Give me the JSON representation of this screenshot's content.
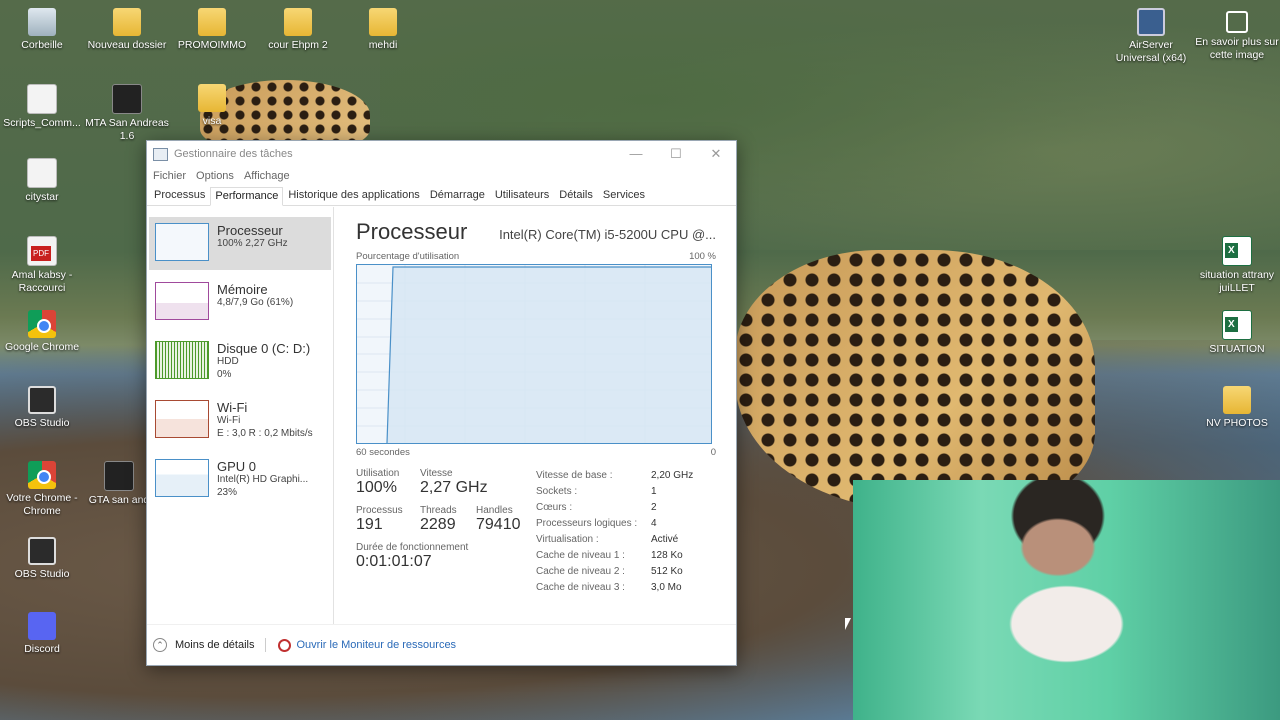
{
  "desktop": {
    "icons": [
      {
        "label": "Corbeille",
        "icon": "recycle-bin-icon"
      },
      {
        "label": "Nouveau dossier",
        "icon": "folder-icon"
      },
      {
        "label": "PROMOIMMO",
        "icon": "zip-folder-icon"
      },
      {
        "label": "cour Ehpm 2",
        "icon": "zip-folder-icon"
      },
      {
        "label": "mehdi",
        "icon": "folder-icon"
      },
      {
        "label": "Scripts_Comm...",
        "icon": "file-icon"
      },
      {
        "label": "MTA San Andreas 1.6",
        "icon": "game-icon"
      },
      {
        "label": "visa",
        "icon": "folder-icon"
      },
      {
        "label": "citystar",
        "icon": "file-icon"
      },
      {
        "label": "Amal kabsy - Raccourci",
        "icon": "pdf-icon"
      },
      {
        "label": "Google Chrome",
        "icon": "chrome-icon"
      },
      {
        "label": "OBS Studio",
        "icon": "obs-icon"
      },
      {
        "label": "Votre Chrome - Chrome",
        "icon": "chrome-icon"
      },
      {
        "label": "GTA san and",
        "icon": "game-icon"
      },
      {
        "label": "OBS Studio",
        "icon": "obs-icon"
      },
      {
        "label": "Discord",
        "icon": "discord-icon"
      },
      {
        "label": "AirServer Universal (x64)",
        "icon": "airserver-icon"
      },
      {
        "label": "En savoir plus sur cette image",
        "icon": "info-icon"
      },
      {
        "label": "situation attrany juiLLET",
        "icon": "excel-icon"
      },
      {
        "label": "SITUATION",
        "icon": "excel-icon"
      },
      {
        "label": "NV PHOTOS",
        "icon": "folder-icon"
      }
    ]
  },
  "taskmgr": {
    "title": "Gestionnaire des tâches",
    "menu": [
      "Fichier",
      "Options",
      "Affichage"
    ],
    "tabs": [
      "Processus",
      "Performance",
      "Historique des applications",
      "Démarrage",
      "Utilisateurs",
      "Détails",
      "Services"
    ],
    "active_tab": "Performance",
    "sidebar": [
      {
        "title": "Processeur",
        "sub1": "100% 2,27 GHz",
        "sub2": "",
        "sub3": ""
      },
      {
        "title": "Mémoire",
        "sub1": "4,8/7,9 Go (61%)",
        "sub2": "",
        "sub3": ""
      },
      {
        "title": "Disque 0 (C: D:)",
        "sub1": "HDD",
        "sub2": "0%",
        "sub3": ""
      },
      {
        "title": "Wi-Fi",
        "sub1": "Wi-Fi",
        "sub2": "E : 3,0 R : 0,2 Mbits/s",
        "sub3": ""
      },
      {
        "title": "GPU 0",
        "sub1": "Intel(R) HD Graphi...",
        "sub2": "23%",
        "sub3": ""
      }
    ],
    "main": {
      "title": "Processeur",
      "cpu_name": "Intel(R) Core(TM) i5-5200U CPU @...",
      "graph_label": "Pourcentage d'utilisation",
      "graph_max": "100 %",
      "graph_time": "60 secondes",
      "graph_min": "0",
      "utilisation_label": "Utilisation",
      "utilisation_value": "100%",
      "vitesse_label": "Vitesse",
      "vitesse_value": "2,27 GHz",
      "processus_label": "Processus",
      "processus_value": "191",
      "threads_label": "Threads",
      "threads_value": "2289",
      "handles_label": "Handles",
      "handles_value": "79410",
      "uptime_label": "Durée de fonctionnement",
      "uptime_value": "0:01:01:07",
      "details": [
        {
          "k": "Vitesse de base :",
          "v": "2,20 GHz"
        },
        {
          "k": "Sockets :",
          "v": "1"
        },
        {
          "k": "Cœurs :",
          "v": "2"
        },
        {
          "k": "Processeurs logiques :",
          "v": "4"
        },
        {
          "k": "Virtualisation :",
          "v": "Activé"
        },
        {
          "k": "Cache de niveau 1 :",
          "v": "128 Ko"
        },
        {
          "k": "Cache de niveau 2 :",
          "v": "512 Ko"
        },
        {
          "k": "Cache de niveau 3 :",
          "v": "3,0 Mo"
        }
      ]
    },
    "footer": {
      "less_details": "Moins de détails",
      "resource_monitor": "Ouvrir le Moniteur de ressources"
    }
  },
  "colors": {
    "cpu_line": "#4a90c8",
    "link": "#2a6ab8"
  }
}
